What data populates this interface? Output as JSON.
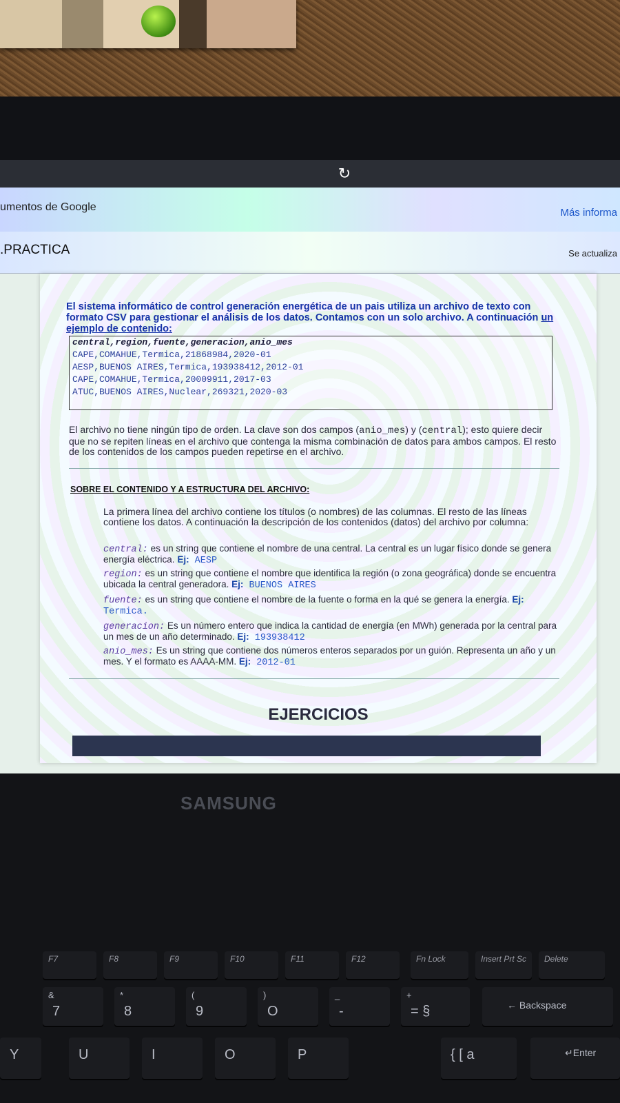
{
  "browser": {
    "gdocs_title": "umentos de Google",
    "more_info": "Más informa"
  },
  "doc": {
    "title": ".PRACTICA",
    "updated": "Se actualiza",
    "intro_part1": "El sistema informático de control generación energética de un pais utiliza un archivo de texto con formato ",
    "intro_csv": "CSV",
    "intro_part2": " para gestionar el análisis de los datos. Contamos con un solo archivo. A continuación ",
    "intro_underlined": "un ejemplo de contenido:",
    "csv_lines": [
      "central,region,fuente,generacion,anio_mes",
      "CAPE,COMAHUE,Termica,21868984,2020-01",
      "AESP,BUENOS AIRES,Termica,193938412,2012-01",
      "CAPE,COMAHUE,Termica,20009911,2017-03",
      "ATUC,BUENOS AIRES,Nuclear,269321,2020-03"
    ],
    "order_p1": "El archivo no tiene ningún tipo de orden. La clave son dos campos (",
    "order_k1": "anio_mes",
    "order_p2": ") y (",
    "order_k2": "central",
    "order_p3": "); esto quiere decir que no se repiten líneas en el archivo que contenga la misma combinación de datos para ambos campos. El resto de los contenidos de los campos pueden repetirse en el archivo.",
    "section_title": "SOBRE EL CONTENIDO Y A ESTRUCTURA DEL ARCHIVO:",
    "desc_intro": "La primera línea del archivo contiene los títulos (o nombres) de las columnas. El resto de las líneas contiene los datos. A continuación la descripción de los contenidos (datos) del archivo por columna:",
    "fields": [
      {
        "name": "central:",
        "desc": " es un string que contiene el nombre de una central. La central es un lugar físico donde se genera energía eléctrica. ",
        "ex_label": "Ej:",
        "ex_value": " AESP"
      },
      {
        "name": "region:",
        "desc": " es un string que contiene el nombre que identifica la región (o zona geográfica) donde se encuentra ubicada la central generadora. ",
        "ex_label": "Ej:",
        "ex_value": "  BUENOS AIRES"
      },
      {
        "name": "fuente:",
        "desc": " es un string que contiene el nombre de la fuente o forma en la qué se genera la energía. ",
        "ex_label": "Ej:",
        "ex_value": " Termica."
      },
      {
        "name": "generacion:",
        "desc": " Es un número entero que indica la cantidad de energía (en MWh) generada por la central para un mes de un año determinado. ",
        "ex_label": "Ej:",
        "ex_value": " 193938412"
      },
      {
        "name": "anio_mes:",
        "desc": "  Es un string que contiene dos números enteros separados por un guión. Representa un año y un mes. Y el formato es AAAA-MM. ",
        "ex_label": "Ej:",
        "ex_value": " 2012-01"
      }
    ],
    "exercises_title": "EJERCICIOS"
  },
  "laptop": {
    "brand": "SAMSUNG",
    "fkeys": [
      "F7",
      "F8",
      "F9",
      "F10",
      "F11",
      "F12",
      "Fn Lock",
      "Insert Prt Sc",
      "Delete"
    ],
    "num_keys": [
      {
        "top": "&",
        "bottom": "7"
      },
      {
        "top": "*",
        "bottom": "8"
      },
      {
        "top": "(",
        "bottom": "9"
      },
      {
        "top": ")",
        "bottom": "O"
      },
      {
        "top": "_",
        "bottom": "-"
      },
      {
        "top": "+",
        "bottom": "= §"
      }
    ],
    "backspace": "← Backspace",
    "letter_keys": [
      "Y",
      "U",
      "I",
      "O",
      "P",
      "{ [ a"
    ],
    "enter": "↵Enter"
  }
}
